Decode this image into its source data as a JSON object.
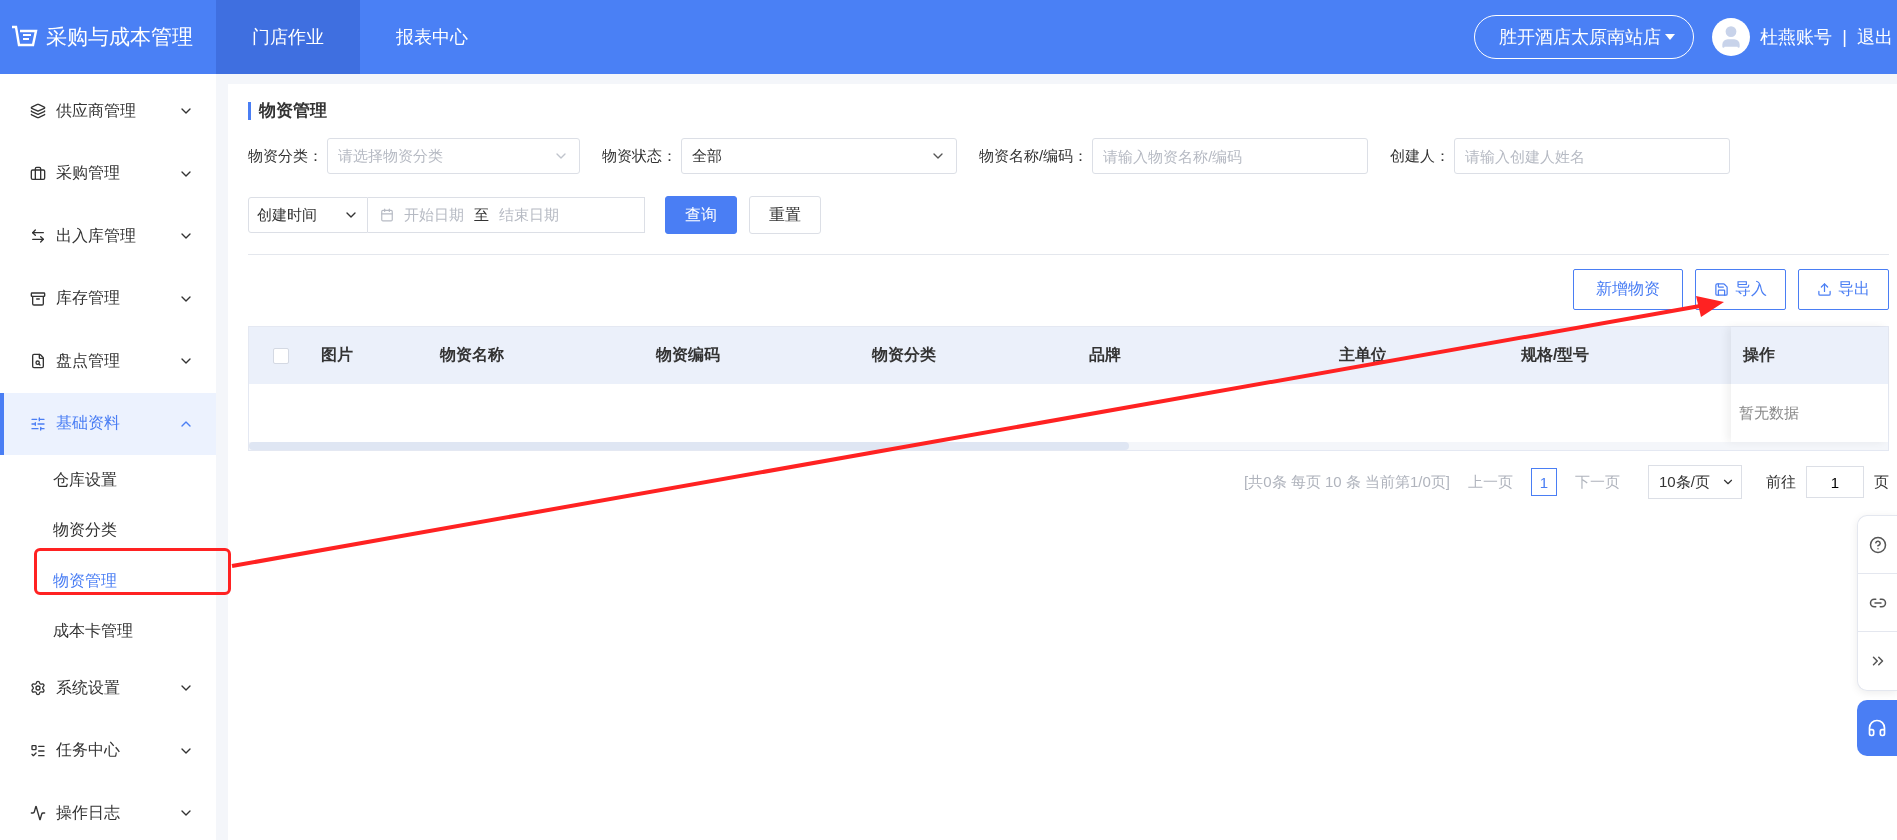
{
  "app": {
    "title": "采购与成本管理"
  },
  "top_nav": [
    {
      "label": "门店作业",
      "selected": true
    },
    {
      "label": "报表中心",
      "selected": false
    }
  ],
  "store_selector": "胜开酒店太原南站店",
  "user": {
    "name": "杜燕账号",
    "separator": "|",
    "logout": "退出"
  },
  "sidebar": {
    "items": [
      {
        "label": "供应商管理",
        "selected": false,
        "expanded": false
      },
      {
        "label": "采购管理",
        "selected": false,
        "expanded": false
      },
      {
        "label": "出入库管理",
        "selected": false,
        "expanded": false
      },
      {
        "label": "库存管理",
        "selected": false,
        "expanded": false
      },
      {
        "label": "盘点管理",
        "selected": false,
        "expanded": false
      },
      {
        "label": "基础资料",
        "selected": true,
        "expanded": true,
        "children": [
          {
            "label": "仓库设置",
            "selected": false
          },
          {
            "label": "物资分类",
            "selected": false
          },
          {
            "label": "物资管理",
            "selected": true
          },
          {
            "label": "成本卡管理",
            "selected": false
          }
        ]
      },
      {
        "label": "系统设置",
        "selected": false,
        "expanded": false
      },
      {
        "label": "任务中心",
        "selected": false,
        "expanded": false
      },
      {
        "label": "操作日志",
        "selected": false,
        "expanded": false
      }
    ]
  },
  "page_title": "物资管理",
  "filters": [
    {
      "label": "物资分类：",
      "kind": "select",
      "placeholder": "请选择物资分类"
    },
    {
      "label": "物资状态：",
      "kind": "select",
      "value": "全部"
    },
    {
      "label": "物资名称/编码：",
      "kind": "input",
      "placeholder": "请输入物资名称/编码"
    },
    {
      "label": "创建人：",
      "kind": "input",
      "placeholder": "请输入创建人姓名"
    }
  ],
  "date_filter": {
    "field": "创建时间",
    "start_placeholder": "开始日期",
    "separator": "至",
    "end_placeholder": "结束日期"
  },
  "search_buttons": [
    {
      "label": "查询",
      "kind": "primary"
    },
    {
      "label": "重置",
      "kind": "default"
    }
  ],
  "actions": [
    {
      "label": "新增物资",
      "kind": "plain"
    },
    {
      "label": "导入",
      "kind": "import"
    },
    {
      "label": "导出",
      "kind": "export"
    }
  ],
  "table": {
    "select_all": {
      "checked": false
    },
    "columns": [
      "图片",
      "物资名称",
      "物资编码",
      "物资分类",
      "品牌",
      "主单位",
      "规格/型号"
    ],
    "fixed_column": "操作",
    "empty_text": "暂无数据"
  },
  "pagination": {
    "summary": "[共0条 每页 10 条 当前第1/0页]",
    "prev": "上一页",
    "pages": [
      {
        "label": "1",
        "selected": true
      }
    ],
    "next": "下一页",
    "page_size": "10条/页",
    "goto_label": "前往",
    "goto_value": "1",
    "goto_suffix": "页"
  },
  "floating_tools": [
    {
      "kind": "help"
    },
    {
      "kind": "link"
    },
    {
      "kind": "collapse"
    }
  ],
  "support_button": {
    "kind": "support"
  }
}
